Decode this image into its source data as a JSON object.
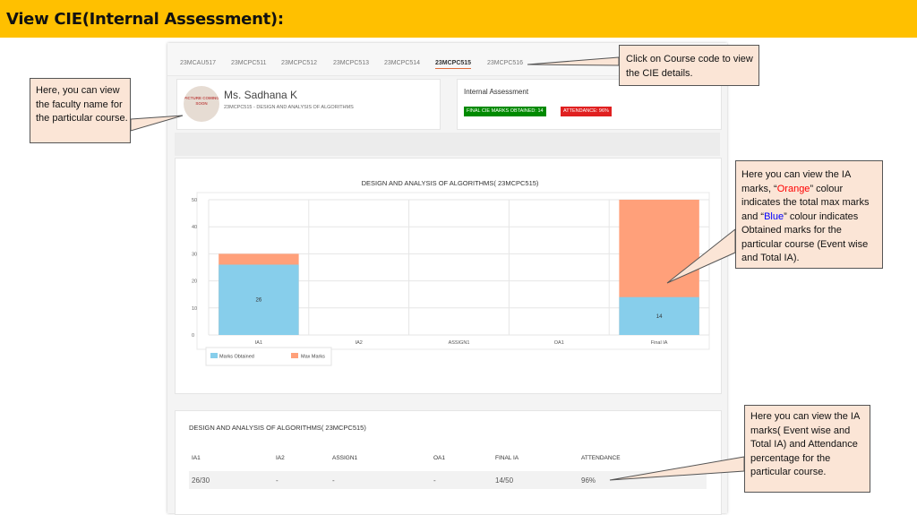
{
  "slide": {
    "title": "View CIE(Internal Assessment):",
    "header_color": "#FFC000"
  },
  "tabs": [
    {
      "label": "23MCAU517",
      "active": false
    },
    {
      "label": "23MCPC511",
      "active": false
    },
    {
      "label": "23MCPC512",
      "active": false
    },
    {
      "label": "23MCPC513",
      "active": false
    },
    {
      "label": "23MCPC514",
      "active": false
    },
    {
      "label": "23MCPC515",
      "active": true
    },
    {
      "label": "23MCPC516",
      "active": false
    }
  ],
  "faculty": {
    "avatar_text": "PICTURE COMING SOON",
    "name": "Ms. Sadhana K",
    "course": "23MCPC515 - DESIGN AND ANALYSIS OF ALGORITHMS"
  },
  "internal_assessment": {
    "title": "Internal Assessment",
    "final_marks_badge": "FINAL CIE MARKS OBTAINED: 14",
    "attendance_badge": "ATTENDANCE: 96%",
    "colors": {
      "final": "#008a00",
      "attendance": "#e02020"
    }
  },
  "chart_data": {
    "type": "bar",
    "title": "DESIGN AND ANALYSIS OF ALGORITHMS( 23MCPC515)",
    "categories": [
      "IA1",
      "IA2",
      "ASSIGN1",
      "OA1",
      "Final IA"
    ],
    "series": [
      {
        "name": "Marks Obtained",
        "values": [
          26,
          0,
          0,
          0,
          14
        ],
        "color": "#87CEEB"
      },
      {
        "name": "Max Marks",
        "values": [
          30,
          0,
          0,
          0,
          50
        ],
        "color": "#FFA07A"
      }
    ],
    "data_labels": [
      "26",
      "",
      "",
      "",
      "14"
    ],
    "y_ticks": [
      0,
      10,
      20,
      30,
      40,
      50
    ],
    "ylim": [
      0,
      50
    ],
    "grid": true,
    "legend_position": "bottom-left"
  },
  "table": {
    "title": "DESIGN AND ANALYSIS OF ALGORITHMS( 23MCPC515)",
    "headers": [
      "IA1",
      "IA2",
      "ASSIGN1",
      "OA1",
      "FINAL IA",
      "ATTENDANCE"
    ],
    "row": [
      "26/30",
      "-",
      "-",
      "-",
      "14/50",
      "96%"
    ]
  },
  "callouts": {
    "course_code": "Click on Course code to view the CIE details.",
    "faculty": "Here, you can view the faculty name for the particular course.",
    "chart": {
      "part1": "Here you can view the IA marks, “",
      "orange": "Orange",
      "part2": "” colour indicates the total max marks and “",
      "blue": "Blue",
      "part3": "” colour indicates Obtained marks for the particular course (Event wise and Total IA)."
    },
    "table": "Here you can view the IA marks( Event wise and Total IA) and Attendance percentage for the particular course."
  }
}
